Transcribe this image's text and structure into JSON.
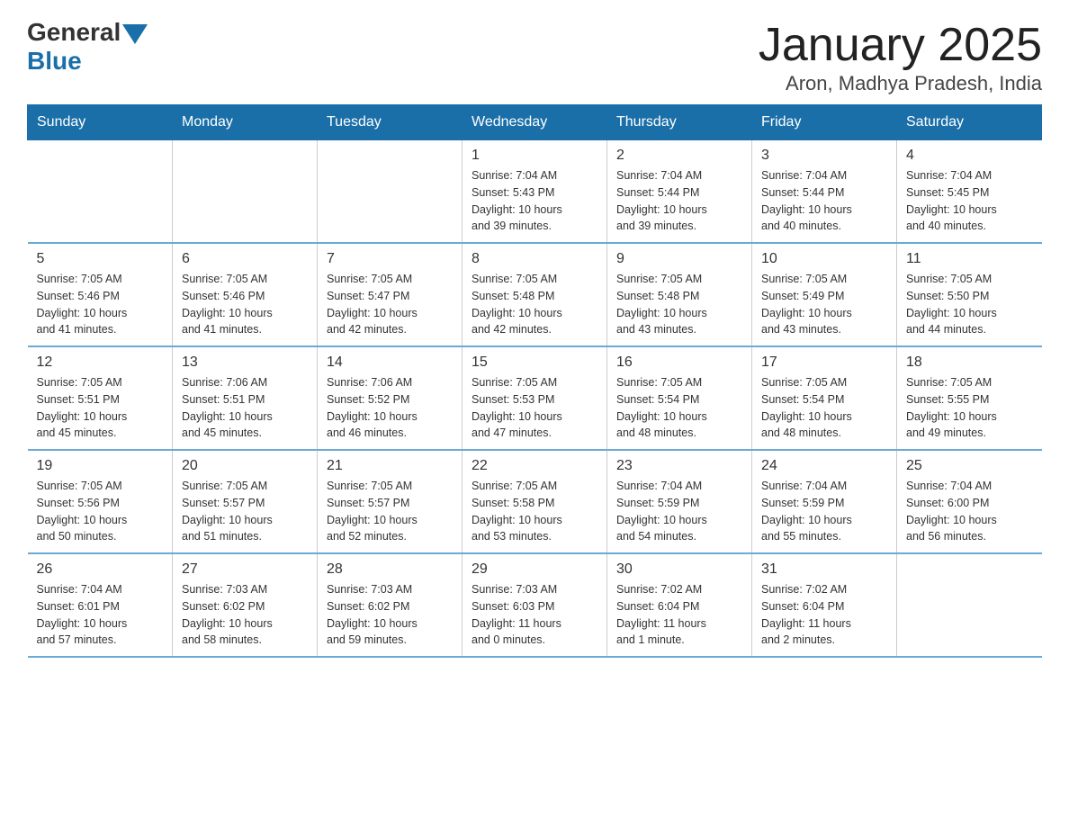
{
  "header": {
    "logo_general": "General",
    "logo_blue": "Blue",
    "title": "January 2025",
    "subtitle": "Aron, Madhya Pradesh, India"
  },
  "weekdays": [
    "Sunday",
    "Monday",
    "Tuesday",
    "Wednesday",
    "Thursday",
    "Friday",
    "Saturday"
  ],
  "weeks": [
    [
      {
        "day": "",
        "info": ""
      },
      {
        "day": "",
        "info": ""
      },
      {
        "day": "",
        "info": ""
      },
      {
        "day": "1",
        "info": "Sunrise: 7:04 AM\nSunset: 5:43 PM\nDaylight: 10 hours\nand 39 minutes."
      },
      {
        "day": "2",
        "info": "Sunrise: 7:04 AM\nSunset: 5:44 PM\nDaylight: 10 hours\nand 39 minutes."
      },
      {
        "day": "3",
        "info": "Sunrise: 7:04 AM\nSunset: 5:44 PM\nDaylight: 10 hours\nand 40 minutes."
      },
      {
        "day": "4",
        "info": "Sunrise: 7:04 AM\nSunset: 5:45 PM\nDaylight: 10 hours\nand 40 minutes."
      }
    ],
    [
      {
        "day": "5",
        "info": "Sunrise: 7:05 AM\nSunset: 5:46 PM\nDaylight: 10 hours\nand 41 minutes."
      },
      {
        "day": "6",
        "info": "Sunrise: 7:05 AM\nSunset: 5:46 PM\nDaylight: 10 hours\nand 41 minutes."
      },
      {
        "day": "7",
        "info": "Sunrise: 7:05 AM\nSunset: 5:47 PM\nDaylight: 10 hours\nand 42 minutes."
      },
      {
        "day": "8",
        "info": "Sunrise: 7:05 AM\nSunset: 5:48 PM\nDaylight: 10 hours\nand 42 minutes."
      },
      {
        "day": "9",
        "info": "Sunrise: 7:05 AM\nSunset: 5:48 PM\nDaylight: 10 hours\nand 43 minutes."
      },
      {
        "day": "10",
        "info": "Sunrise: 7:05 AM\nSunset: 5:49 PM\nDaylight: 10 hours\nand 43 minutes."
      },
      {
        "day": "11",
        "info": "Sunrise: 7:05 AM\nSunset: 5:50 PM\nDaylight: 10 hours\nand 44 minutes."
      }
    ],
    [
      {
        "day": "12",
        "info": "Sunrise: 7:05 AM\nSunset: 5:51 PM\nDaylight: 10 hours\nand 45 minutes."
      },
      {
        "day": "13",
        "info": "Sunrise: 7:06 AM\nSunset: 5:51 PM\nDaylight: 10 hours\nand 45 minutes."
      },
      {
        "day": "14",
        "info": "Sunrise: 7:06 AM\nSunset: 5:52 PM\nDaylight: 10 hours\nand 46 minutes."
      },
      {
        "day": "15",
        "info": "Sunrise: 7:05 AM\nSunset: 5:53 PM\nDaylight: 10 hours\nand 47 minutes."
      },
      {
        "day": "16",
        "info": "Sunrise: 7:05 AM\nSunset: 5:54 PM\nDaylight: 10 hours\nand 48 minutes."
      },
      {
        "day": "17",
        "info": "Sunrise: 7:05 AM\nSunset: 5:54 PM\nDaylight: 10 hours\nand 48 minutes."
      },
      {
        "day": "18",
        "info": "Sunrise: 7:05 AM\nSunset: 5:55 PM\nDaylight: 10 hours\nand 49 minutes."
      }
    ],
    [
      {
        "day": "19",
        "info": "Sunrise: 7:05 AM\nSunset: 5:56 PM\nDaylight: 10 hours\nand 50 minutes."
      },
      {
        "day": "20",
        "info": "Sunrise: 7:05 AM\nSunset: 5:57 PM\nDaylight: 10 hours\nand 51 minutes."
      },
      {
        "day": "21",
        "info": "Sunrise: 7:05 AM\nSunset: 5:57 PM\nDaylight: 10 hours\nand 52 minutes."
      },
      {
        "day": "22",
        "info": "Sunrise: 7:05 AM\nSunset: 5:58 PM\nDaylight: 10 hours\nand 53 minutes."
      },
      {
        "day": "23",
        "info": "Sunrise: 7:04 AM\nSunset: 5:59 PM\nDaylight: 10 hours\nand 54 minutes."
      },
      {
        "day": "24",
        "info": "Sunrise: 7:04 AM\nSunset: 5:59 PM\nDaylight: 10 hours\nand 55 minutes."
      },
      {
        "day": "25",
        "info": "Sunrise: 7:04 AM\nSunset: 6:00 PM\nDaylight: 10 hours\nand 56 minutes."
      }
    ],
    [
      {
        "day": "26",
        "info": "Sunrise: 7:04 AM\nSunset: 6:01 PM\nDaylight: 10 hours\nand 57 minutes."
      },
      {
        "day": "27",
        "info": "Sunrise: 7:03 AM\nSunset: 6:02 PM\nDaylight: 10 hours\nand 58 minutes."
      },
      {
        "day": "28",
        "info": "Sunrise: 7:03 AM\nSunset: 6:02 PM\nDaylight: 10 hours\nand 59 minutes."
      },
      {
        "day": "29",
        "info": "Sunrise: 7:03 AM\nSunset: 6:03 PM\nDaylight: 11 hours\nand 0 minutes."
      },
      {
        "day": "30",
        "info": "Sunrise: 7:02 AM\nSunset: 6:04 PM\nDaylight: 11 hours\nand 1 minute."
      },
      {
        "day": "31",
        "info": "Sunrise: 7:02 AM\nSunset: 6:04 PM\nDaylight: 11 hours\nand 2 minutes."
      },
      {
        "day": "",
        "info": ""
      }
    ]
  ]
}
